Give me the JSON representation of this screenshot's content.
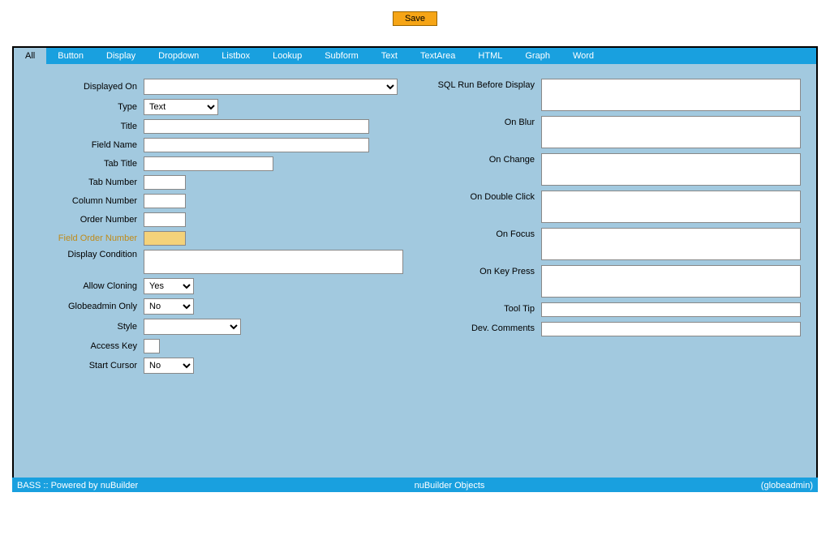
{
  "topbar": {
    "save": "Save"
  },
  "tabs": [
    {
      "name": "all",
      "label": "All",
      "active": true
    },
    {
      "name": "button",
      "label": "Button"
    },
    {
      "name": "display",
      "label": "Display"
    },
    {
      "name": "dropdown",
      "label": "Dropdown"
    },
    {
      "name": "listbox",
      "label": "Listbox"
    },
    {
      "name": "lookup",
      "label": "Lookup"
    },
    {
      "name": "subform",
      "label": "Subform"
    },
    {
      "name": "text",
      "label": "Text"
    },
    {
      "name": "textarea",
      "label": "TextArea"
    },
    {
      "name": "html",
      "label": "HTML"
    },
    {
      "name": "graph",
      "label": "Graph"
    },
    {
      "name": "word",
      "label": "Word"
    }
  ],
  "left": {
    "displayed_on": {
      "label": "Displayed On",
      "value": ""
    },
    "type": {
      "label": "Type",
      "value": "Text"
    },
    "title": {
      "label": "Title",
      "value": ""
    },
    "field_name": {
      "label": "Field Name",
      "value": ""
    },
    "tab_title": {
      "label": "Tab Title",
      "value": ""
    },
    "tab_number": {
      "label": "Tab Number",
      "value": ""
    },
    "column_number": {
      "label": "Column Number",
      "value": ""
    },
    "order_number": {
      "label": "Order Number",
      "value": ""
    },
    "field_order_number": {
      "label": "Field Order Number",
      "value": ""
    },
    "display_condition": {
      "label": "Display Condition",
      "value": ""
    },
    "allow_cloning": {
      "label": "Allow Cloning",
      "value": "Yes"
    },
    "globeadmin_only": {
      "label": "Globeadmin Only",
      "value": "No"
    },
    "style": {
      "label": "Style",
      "value": ""
    },
    "access_key": {
      "label": "Access Key",
      "value": ""
    },
    "start_cursor": {
      "label": "Start Cursor",
      "value": "No"
    }
  },
  "right": {
    "sql_run_before": {
      "label": "SQL Run Before Display",
      "value": ""
    },
    "on_blur": {
      "label": "On Blur",
      "value": ""
    },
    "on_change": {
      "label": "On Change",
      "value": ""
    },
    "on_double_click": {
      "label": "On Double Click",
      "value": ""
    },
    "on_focus": {
      "label": "On Focus",
      "value": ""
    },
    "on_key_press": {
      "label": "On Key Press",
      "value": ""
    },
    "tool_tip": {
      "label": "Tool Tip",
      "value": ""
    },
    "dev_comments": {
      "label": "Dev. Comments",
      "value": ""
    }
  },
  "footer": {
    "left": "BASS :: Powered by nuBuilder",
    "center": "nuBuilder Objects",
    "right": "(globeadmin)"
  }
}
